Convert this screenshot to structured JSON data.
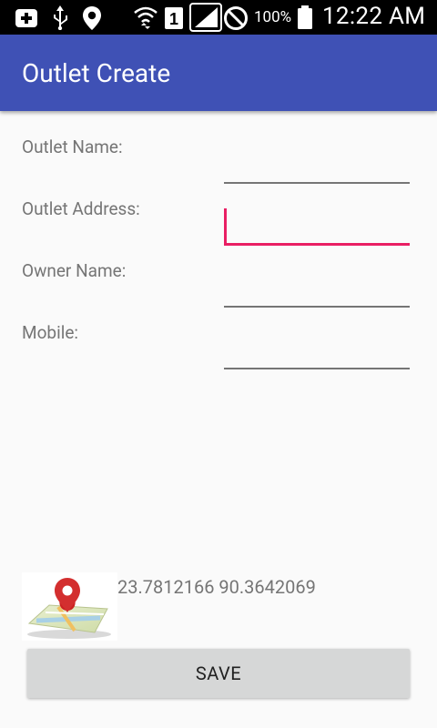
{
  "status_bar": {
    "icons": [
      "add-notification-icon",
      "usb-icon",
      "location-icon",
      "wifi-icon",
      "sim-1-icon",
      "signal-icon",
      "do-not-disturb-icon",
      "battery-icon"
    ],
    "sim_slot": "1",
    "battery_percent": "100%",
    "time": "12:22 AM"
  },
  "app_bar": {
    "title": "Outlet Create",
    "color": "#3f51b5"
  },
  "form": {
    "fields": [
      {
        "label": "Outlet Name:",
        "value": ""
      },
      {
        "label": "Outlet Address:",
        "value": "",
        "focused": true
      },
      {
        "label": "Owner Name:",
        "value": ""
      },
      {
        "label": "Mobile:",
        "value": ""
      }
    ],
    "accent": "#e91e63"
  },
  "location": {
    "icon": "map-pin-icon",
    "coordinates": "23.7812166 90.3642069"
  },
  "actions": {
    "save_label": "SAVE"
  }
}
